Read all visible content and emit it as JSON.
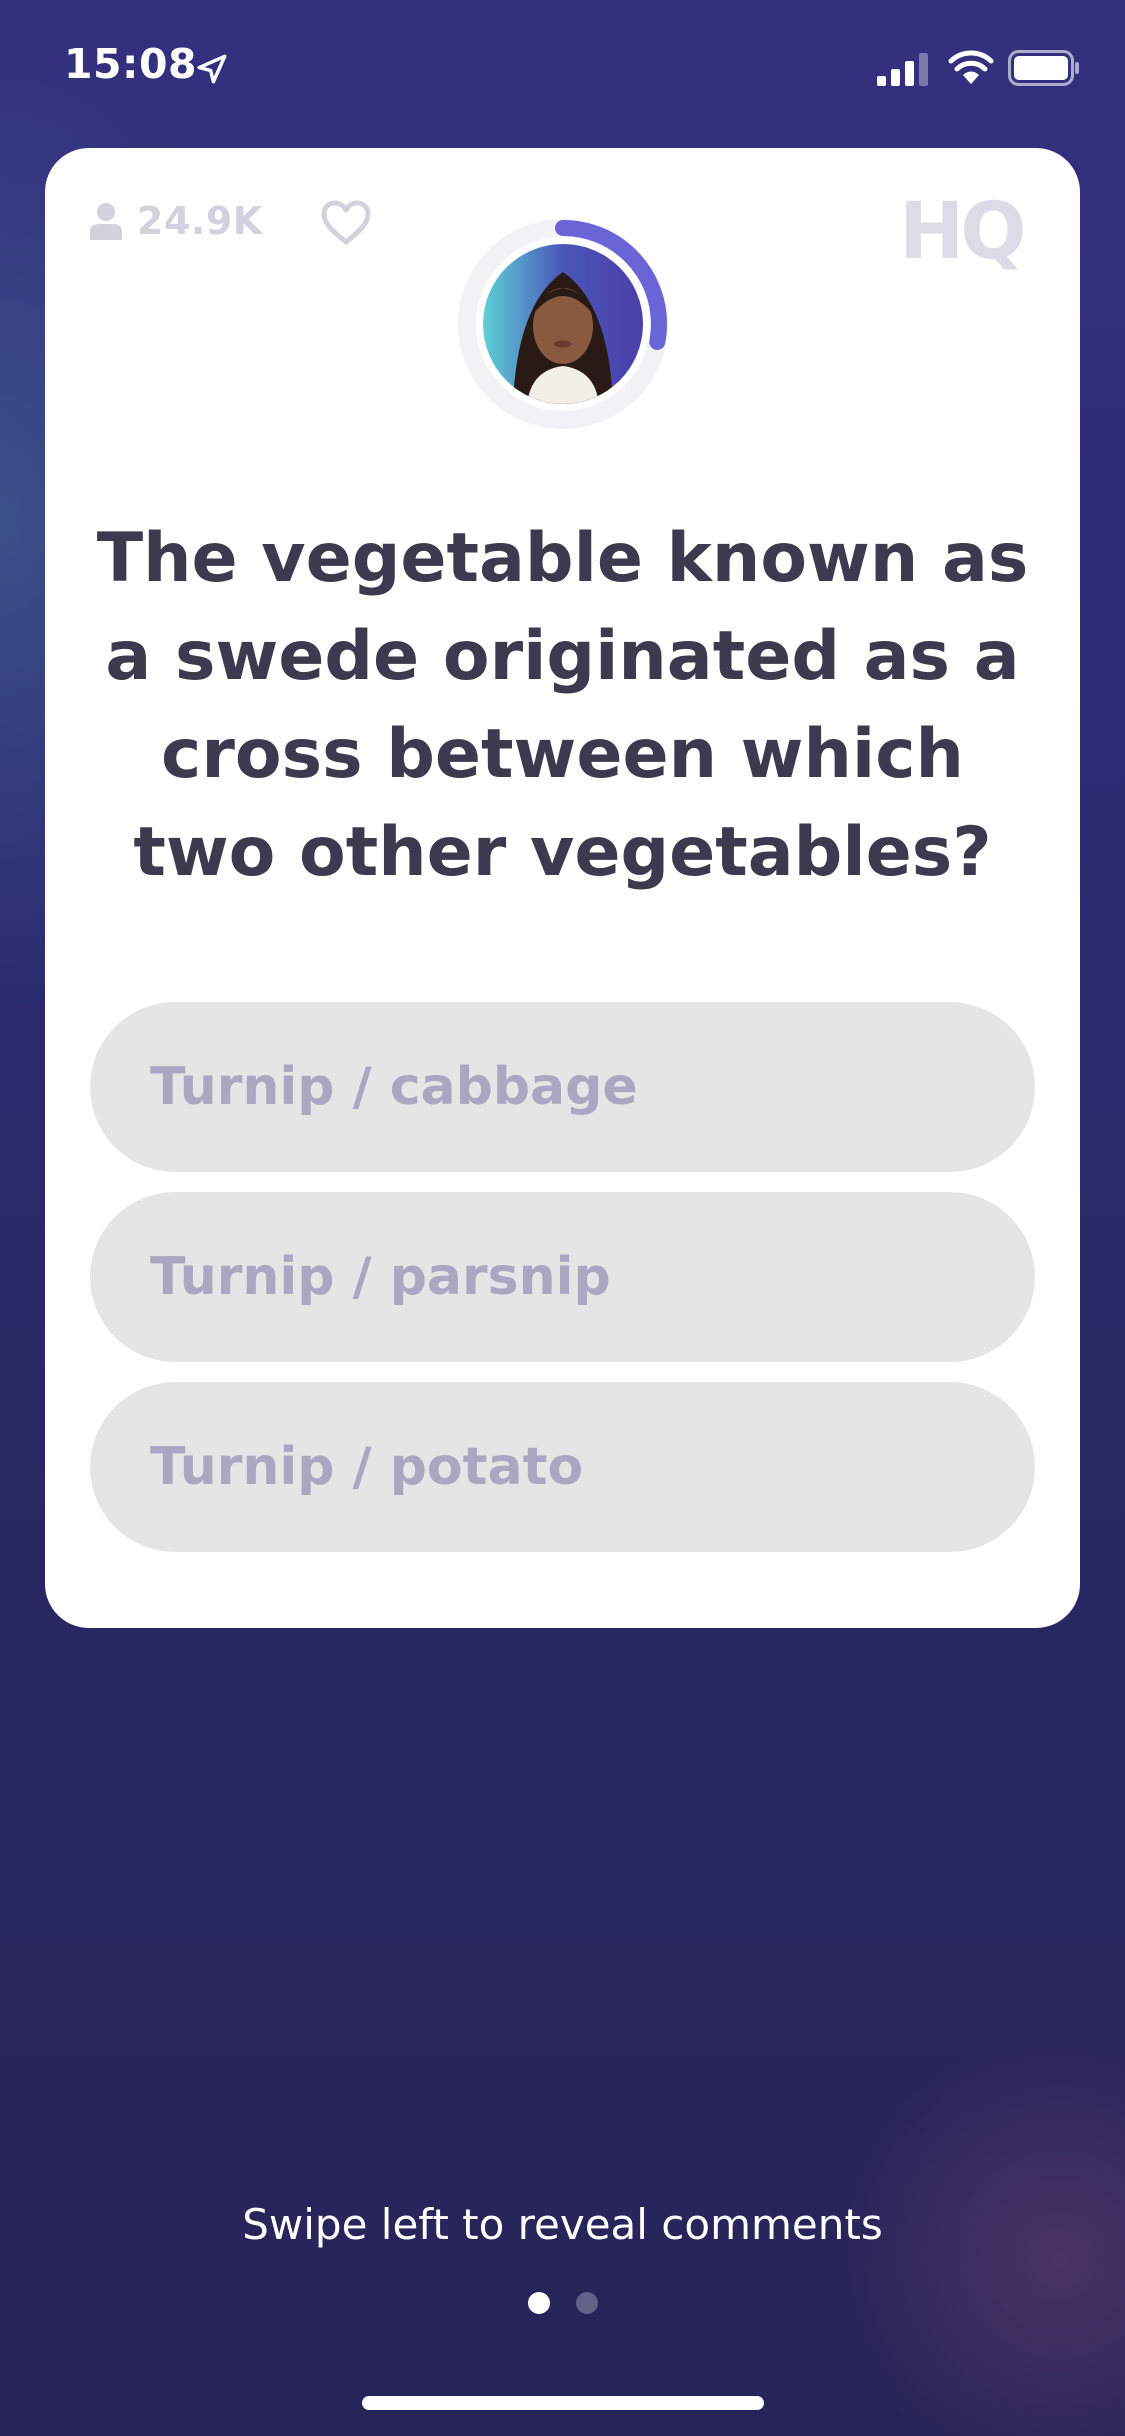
{
  "status_bar": {
    "time": "15:08",
    "icons": [
      "location-arrow-icon",
      "cellular-signal-icon",
      "wifi-icon",
      "battery-icon"
    ]
  },
  "card": {
    "viewer_count": "24.9K",
    "logo_text": "HQ",
    "question": "The vegetable known as a swede originated as a cross between which two other vegetables?",
    "answers": [
      {
        "label": "Turnip / cabbage"
      },
      {
        "label": "Turnip / parsnip"
      },
      {
        "label": "Turnip / potato"
      }
    ],
    "timer_progress": 0.28
  },
  "footer": {
    "swipe_hint": "Swipe left to reveal comments",
    "page_count": 2,
    "active_page": 1
  },
  "colors": {
    "accent": "#6b64d6",
    "background": "#2c2a6c",
    "answer_bg": "#e5e5e6",
    "answer_text": "#a9a7c2",
    "question_text": "#3b3a4e"
  }
}
